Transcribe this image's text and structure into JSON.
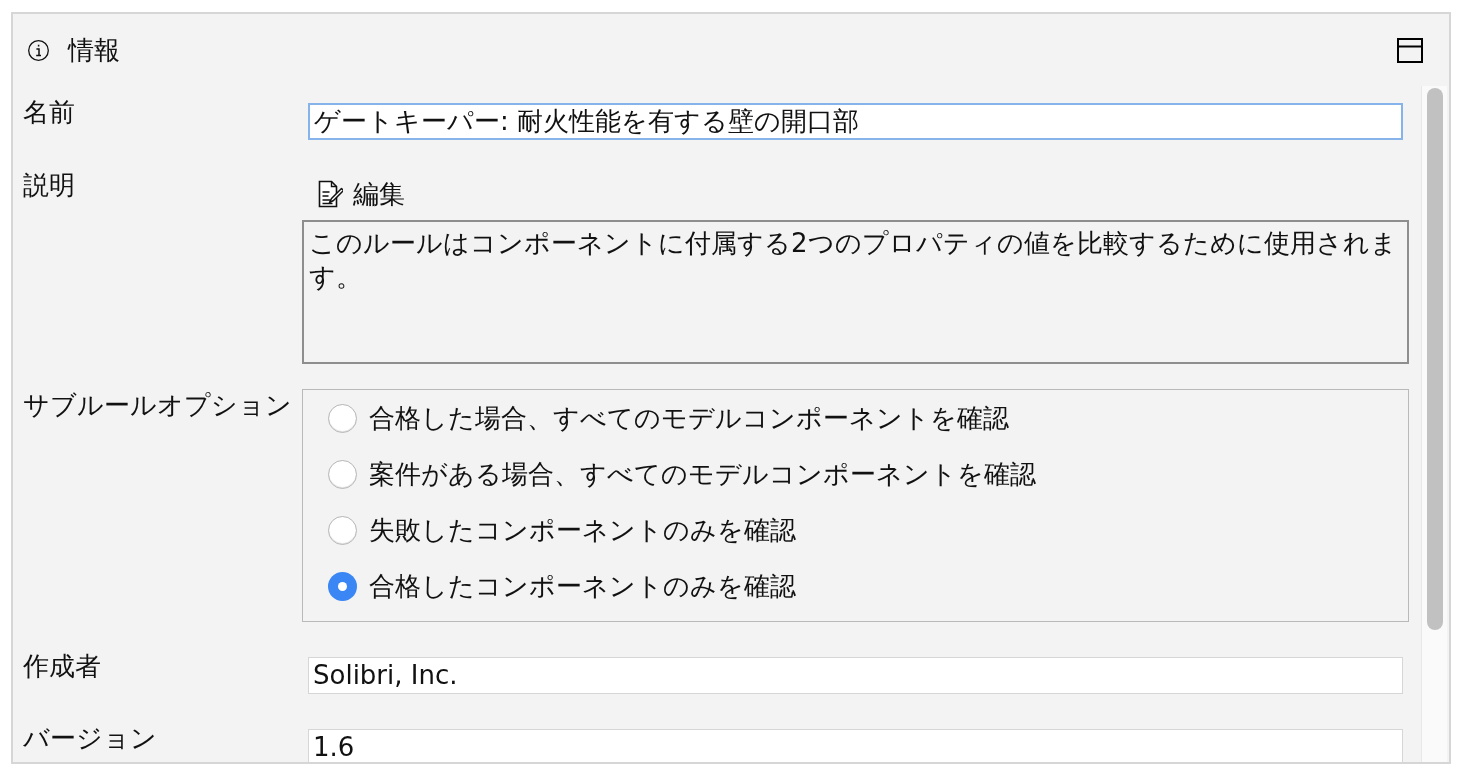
{
  "panel": {
    "title": "情報"
  },
  "form": [
    {
      "kind": "text",
      "label": "名前",
      "value": "ゲートキーパー: 耐火性能を有する壁の開口部",
      "focused": true
    },
    {
      "kind": "description",
      "label": "説明",
      "edit_button": "編集",
      "text": "このルールはコンポーネントに付属する2つのプロパティの値を比較するために使用されます。"
    },
    {
      "kind": "radio_group",
      "label": "サブルールオプション",
      "options": [
        {
          "label": "合格した場合、すべてのモデルコンポーネントを確認",
          "selected": false
        },
        {
          "label": "案件がある場合、すべてのモデルコンポーネントを確認",
          "selected": false
        },
        {
          "label": "失敗したコンポーネントのみを確認",
          "selected": false
        },
        {
          "label": "合格したコンポーネントのみを確認",
          "selected": true
        }
      ]
    },
    {
      "kind": "text",
      "label": "作成者",
      "value": "Solibri, Inc.",
      "focused": false
    },
    {
      "kind": "text",
      "label": "バージョン",
      "value": "1.6",
      "focused": false
    }
  ]
}
